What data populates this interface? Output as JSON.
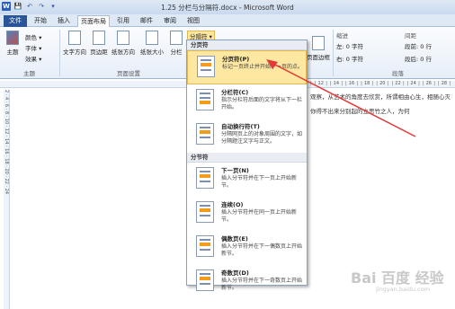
{
  "window": {
    "title": "1.25 分栏与分隔符.docx - Microsoft Word"
  },
  "qat": [
    "W",
    "💾",
    "↶",
    "↷",
    "▾"
  ],
  "tabs": [
    "文件",
    "开始",
    "插入",
    "页面布局",
    "引用",
    "邮件",
    "审阅",
    "视图"
  ],
  "ribbon": {
    "theme_group": {
      "label": "主题",
      "theme_btn": "主题",
      "colors": "颜色 ▾",
      "fonts": "字体 ▾",
      "effects": "效果 ▾"
    },
    "page_setup": {
      "label": "页面设置",
      "buttons": [
        "文字方向",
        "页边距",
        "纸张方向",
        "纸张大小",
        "分栏"
      ]
    },
    "breaks_btn": "分隔符 ▾",
    "indent": {
      "label": "缩进",
      "left": "左: 0 字符",
      "right": "右: 0 字符"
    },
    "spacing": {
      "label": "间距",
      "before": "段前: 0 行",
      "after": "段后: 0 行"
    },
    "paragraph_label": "段落",
    "page_border": "页面边框"
  },
  "ruler_text": "│ 8 │ │ 6 │ │ 4 │ │ 2 │      │ 2 │ │ 4 │ │ 6 │ │ 8 │ │ 10 │ │ 12 │ │ 14 │ │ 16 │ │ 18 │ │ 20 │ │ 22 │ │ 24 │ │ 26 │ │ 28 │",
  "vruler_text": "2 · 4 · 6 · 8 · 10 · 12 · 14 · 16 · 18 · 20 · 22 · 24",
  "doc": {
    "line1": "观察，从艺术的角度去欣赏，所谓相由心生，相随心灭",
    "line2": "你得不出来分别起的立思竹之人，为何"
  },
  "dropdown": {
    "header1": "分页符",
    "header2": "分节符",
    "items1": [
      {
        "title": "分页符(P)",
        "desc": "标记一页终止并开始下一页的点。"
      },
      {
        "title": "分栏符(C)",
        "desc": "指示分栏符后面的文字将从下一栏开始。"
      },
      {
        "title": "自动换行符(T)",
        "desc": "分隔网页上的对象周围的文字，如分隔题注文字与正文。"
      }
    ],
    "items2": [
      {
        "title": "下一页(N)",
        "desc": "插入分节符并在下一页上开始新节。"
      },
      {
        "title": "连续(O)",
        "desc": "插入分节符并在同一页上开始新节。"
      },
      {
        "title": "偶数页(E)",
        "desc": "插入分节符并在下一偶数页上开始新节。"
      },
      {
        "title": "奇数页(D)",
        "desc": "插入分节符并在下一奇数页上开始新节。"
      }
    ]
  },
  "watermark": {
    "brand": "Bai 百度 经验",
    "url": "jingyan.baidu.com"
  }
}
